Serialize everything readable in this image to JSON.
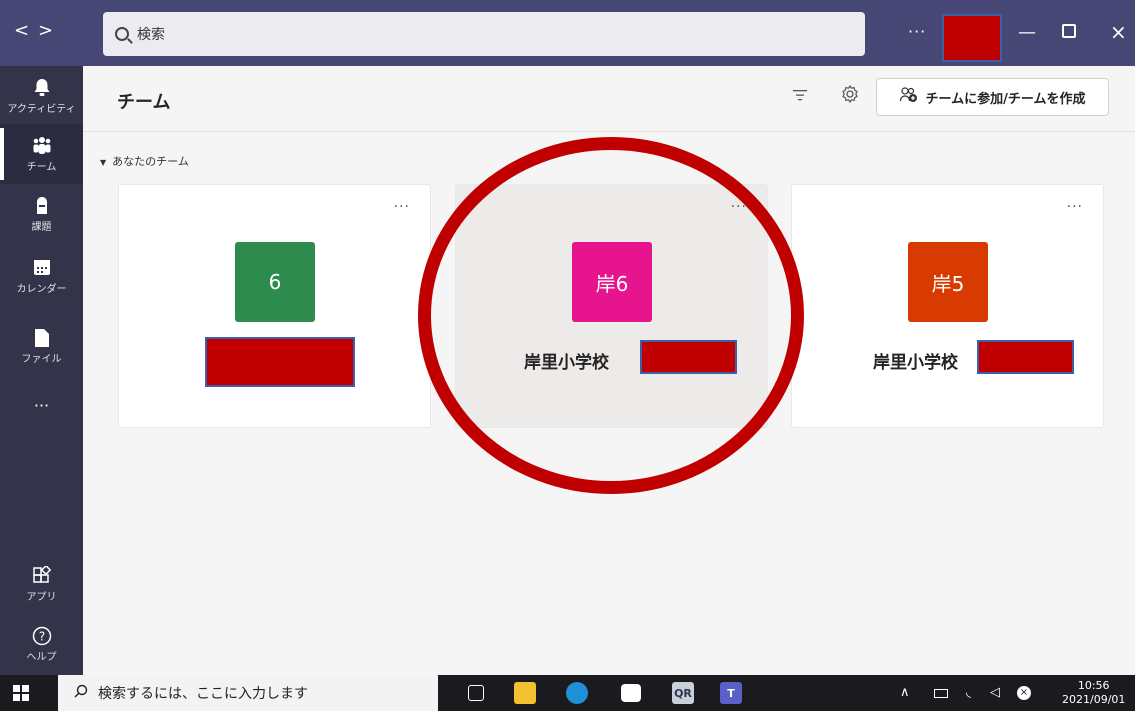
{
  "titlebar": {
    "search_placeholder": "検索",
    "more": "···"
  },
  "rail": {
    "items": [
      {
        "label": "アクティビティ",
        "icon": "bell-icon"
      },
      {
        "label": "チーム",
        "icon": "teams-icon"
      },
      {
        "label": "課題",
        "icon": "backpack-icon"
      },
      {
        "label": "カレンダー",
        "icon": "calendar-icon"
      },
      {
        "label": "ファイル",
        "icon": "file-icon"
      },
      {
        "label": "···",
        "icon": "more-icon"
      }
    ],
    "bottom": [
      {
        "label": "アプリ",
        "icon": "apps-icon"
      },
      {
        "label": "ヘルプ",
        "icon": "help-icon"
      }
    ]
  },
  "header": {
    "title": "チーム",
    "join_button": "チームに参加/チームを作成"
  },
  "section": {
    "label": "あなたのチーム"
  },
  "teams": [
    {
      "avatar": "6",
      "name": "",
      "color": "#2e8b4e",
      "more": "···"
    },
    {
      "avatar": "岸6",
      "name": "岸里小学校",
      "color": "#e6158e",
      "more": "···"
    },
    {
      "avatar": "岸5",
      "name": "岸里小学校",
      "color": "#d83b01",
      "more": "···"
    }
  ],
  "taskbar": {
    "search_placeholder": "検索するには、ここに入力します",
    "time": "10:56",
    "date": "2021/09/01"
  },
  "colors": {
    "titlebar": "#464775",
    "rail": "#33344a",
    "redaction": "#c00000"
  }
}
